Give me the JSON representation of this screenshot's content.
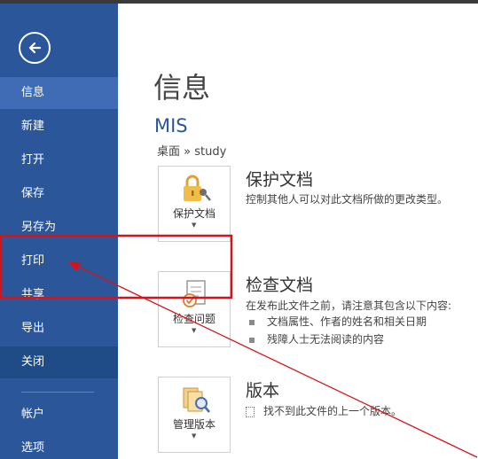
{
  "sidebar": {
    "items": [
      {
        "label": "信息"
      },
      {
        "label": "新建"
      },
      {
        "label": "打开"
      },
      {
        "label": "保存"
      },
      {
        "label": "另存为"
      },
      {
        "label": "打印"
      },
      {
        "label": "共享"
      },
      {
        "label": "导出"
      },
      {
        "label": "关闭"
      },
      {
        "label": "帐户"
      },
      {
        "label": "选项"
      }
    ]
  },
  "main": {
    "title": "信息",
    "doc_name": "MIS",
    "doc_path": "桌面 » study",
    "sections": [
      {
        "button_label": "保护文档",
        "title": "保护文档",
        "description": "控制其他人可以对此文档所做的更改类型。"
      },
      {
        "button_label": "检查问题",
        "title": "检查文档",
        "description": "在发布此文件之前，请注意其包含以下内容:",
        "bullets": [
          "文档属性、作者的姓名和相关日期",
          "残障人士无法阅读的内容"
        ]
      },
      {
        "button_label": "管理版本",
        "title": "版本",
        "description": "找不到此文件的上一个版本。"
      }
    ]
  },
  "colors": {
    "sidebar": "#2b579a",
    "sidebar_active": "#3f6cb4",
    "accent_text": "#2b579a",
    "annotation": "#d4141b"
  },
  "icons": {
    "back": "back-arrow-circle-icon",
    "protect": "lock-key-icon",
    "inspect": "document-check-icon",
    "versions": "documents-search-icon"
  }
}
